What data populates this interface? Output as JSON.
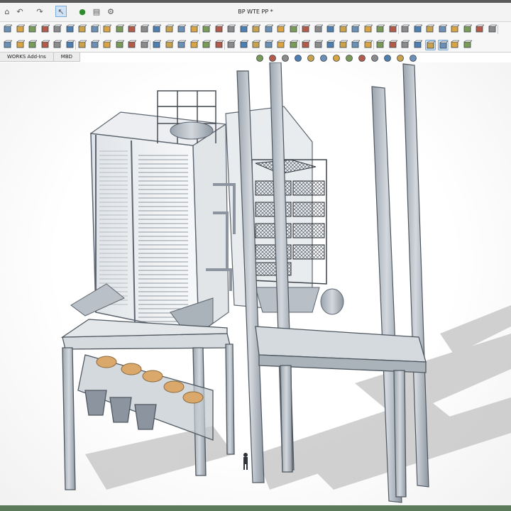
{
  "window": {
    "title": "BP WTE PP *"
  },
  "quick_access": [
    {
      "name": "options-icon",
      "glyph": "⌂"
    },
    {
      "name": "undo-icon",
      "glyph": "↶"
    },
    {
      "name": "redo-icon",
      "glyph": "↷"
    },
    {
      "name": "select-icon",
      "glyph": "↖"
    },
    {
      "name": "traffic-light-icon",
      "glyph": "●"
    },
    {
      "name": "file-properties-icon",
      "glyph": "▤"
    },
    {
      "name": "settings-gear-icon",
      "glyph": "⚙"
    }
  ],
  "tabs": [
    {
      "label": "WORKS Add-Ins",
      "active": false
    },
    {
      "label": "MBD",
      "active": false
    }
  ],
  "colors": {
    "steel": "#a8b0ba",
    "steel_dark": "#5d6670",
    "shadow": "#cfcfcf",
    "accent": "#d9a86a",
    "ui_select": "#cfe3f7"
  }
}
